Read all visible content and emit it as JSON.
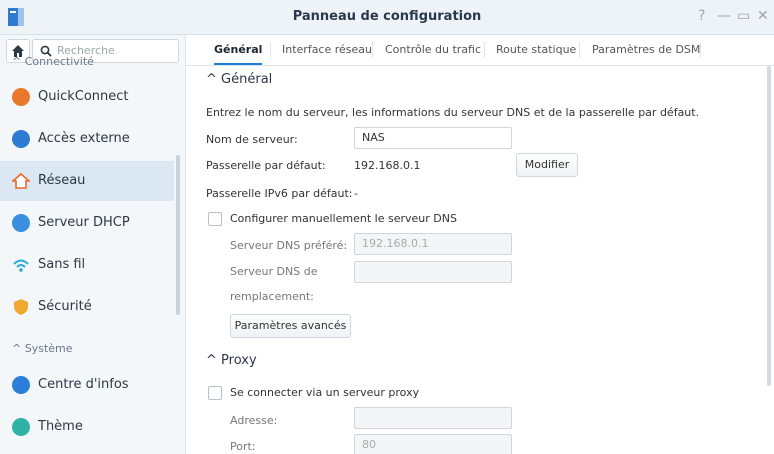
{
  "window": {
    "title": "Panneau de configuration",
    "help": "?",
    "minimize": "—",
    "maximize": "▭",
    "close": "✕"
  },
  "sidebar": {
    "search_placeholder": "Recherche",
    "section_connectivite": "Connectivité",
    "section_systeme": "Système",
    "items": [
      {
        "label": "QuickConnect",
        "color": "#e8792a"
      },
      {
        "label": "Accès externe",
        "color": "#2d7bd3"
      },
      {
        "label": "Réseau",
        "color": "#e8682a"
      },
      {
        "label": "Serveur DHCP",
        "color": "#3a8fe0"
      },
      {
        "label": "Sans fil",
        "color": "#2aa9d8"
      },
      {
        "label": "Sécurité",
        "color": "#f0a930"
      },
      {
        "label": "Centre d'infos",
        "color": "#2b7fd8"
      },
      {
        "label": "Thème",
        "color": "#2fb3a6"
      }
    ]
  },
  "tabs": [
    "Général",
    "Interface réseau",
    "Contrôle du trafic",
    "Route statique",
    "Paramètres de DSM"
  ],
  "general": {
    "heading": "Général",
    "intro": "Entrez le nom du serveur, les informations du serveur DNS et de la passerelle par défaut.",
    "server_name_label": "Nom de serveur:",
    "server_name_value": "NAS",
    "gateway_label": "Passerelle par défaut:",
    "gateway_value": "192.168.0.1",
    "modify_button": "Modifier",
    "ipv6_gateway_label": "Passerelle IPv6 par défaut:",
    "ipv6_gateway_value": "-",
    "manual_dns_label": "Configurer manuellement le serveur DNS",
    "preferred_dns_label": "Serveur DNS préféré:",
    "preferred_dns_value": "192.168.0.1",
    "alt_dns_label_1": "Serveur DNS de",
    "alt_dns_label_2": "remplacement:",
    "advanced_button": "Paramètres avancés"
  },
  "proxy": {
    "heading": "Proxy",
    "connect_label": "Se connecter via un serveur proxy",
    "address_label": "Adresse:",
    "port_label": "Port:",
    "port_value": "80"
  }
}
